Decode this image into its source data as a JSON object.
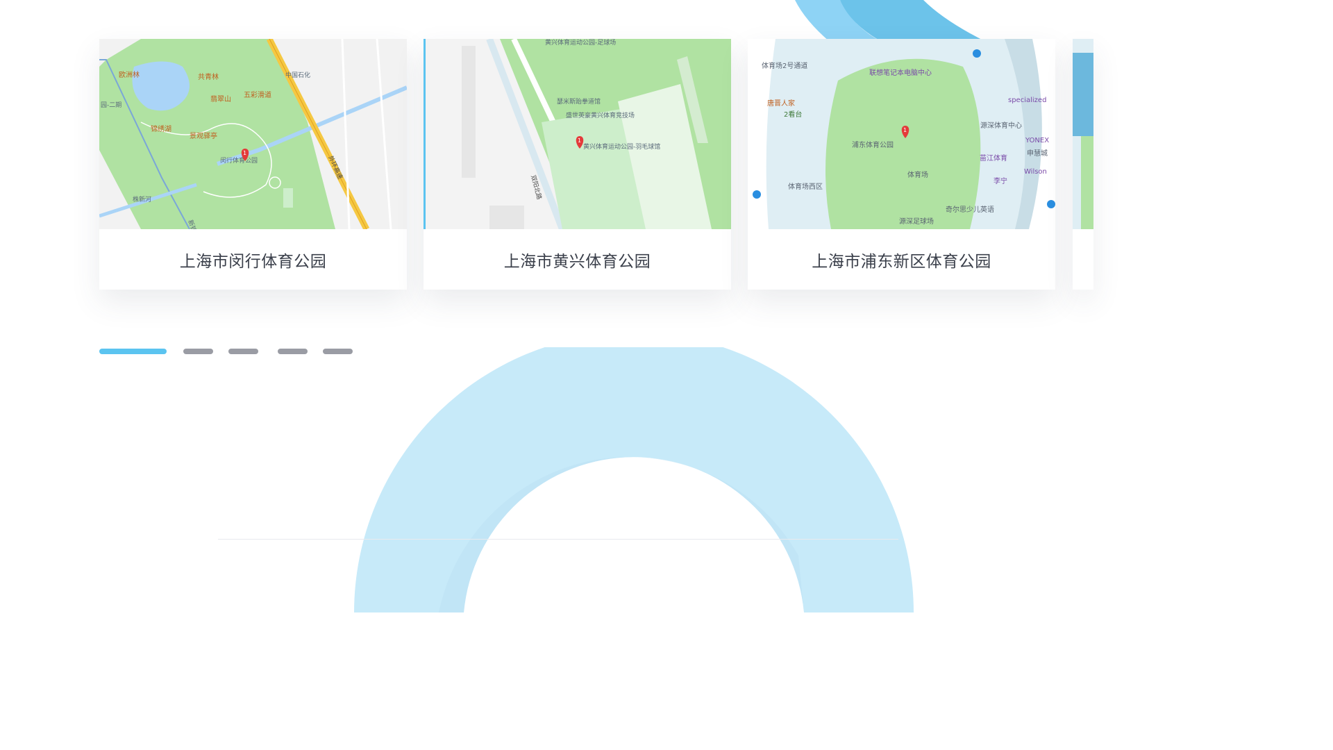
{
  "carousel": {
    "cards": [
      {
        "title": "上海市闵行体育公园",
        "map_labels": {
          "l1": "欧洲林",
          "l2": "共青林",
          "l3": "五彩滑道",
          "l4": "翡翠山",
          "l5": "锦绣湖",
          "l6": "景观驿亭",
          "l7": "闵行体育公园",
          "l8": "中国石化",
          "l9": "园-二期",
          "l10": "外环高速",
          "l11": "株新河",
          "l12": "新镇"
        },
        "pin": "1"
      },
      {
        "title": "上海市黄兴体育公园",
        "map_labels": {
          "l1": "黄兴体育运动公园-足球场",
          "l2": "瑟米斯跆拳道馆",
          "l3": "盛世英豪黄兴体育竞技场",
          "l4": "黄兴体育运动公园-羽毛球馆",
          "l5": "双阳北路"
        },
        "pin": "1"
      },
      {
        "title": "上海市浦东新区体育公园",
        "map_labels": {
          "l1": "体育场2号通道",
          "l2": "联想笔记本电脑中心",
          "l3": "specialized",
          "l4": "唐晋人家",
          "l5": "2看台",
          "l6": "源深体育中心",
          "l7": "浦东体育公园",
          "l8": "YONEX",
          "l9": "申慧城",
          "l10": "苗江体育",
          "l11": "Wilson",
          "l12": "李宁",
          "l13": "体育场",
          "l14": "体育场西区",
          "l15": "奇尔思少儿英语",
          "l16": "源深足球场"
        },
        "pin": "1"
      }
    ]
  },
  "pager": {
    "count": 5,
    "active_index": 0
  },
  "colors": {
    "accent": "#5bc4f0",
    "pager_inactive": "#9a9ca4",
    "park_green": "#b0e2a2",
    "water": "#aad4f7",
    "road_yellow": "#f5c842",
    "title_text": "#3a3f4a",
    "deco_blue": "#c7eaf9"
  }
}
